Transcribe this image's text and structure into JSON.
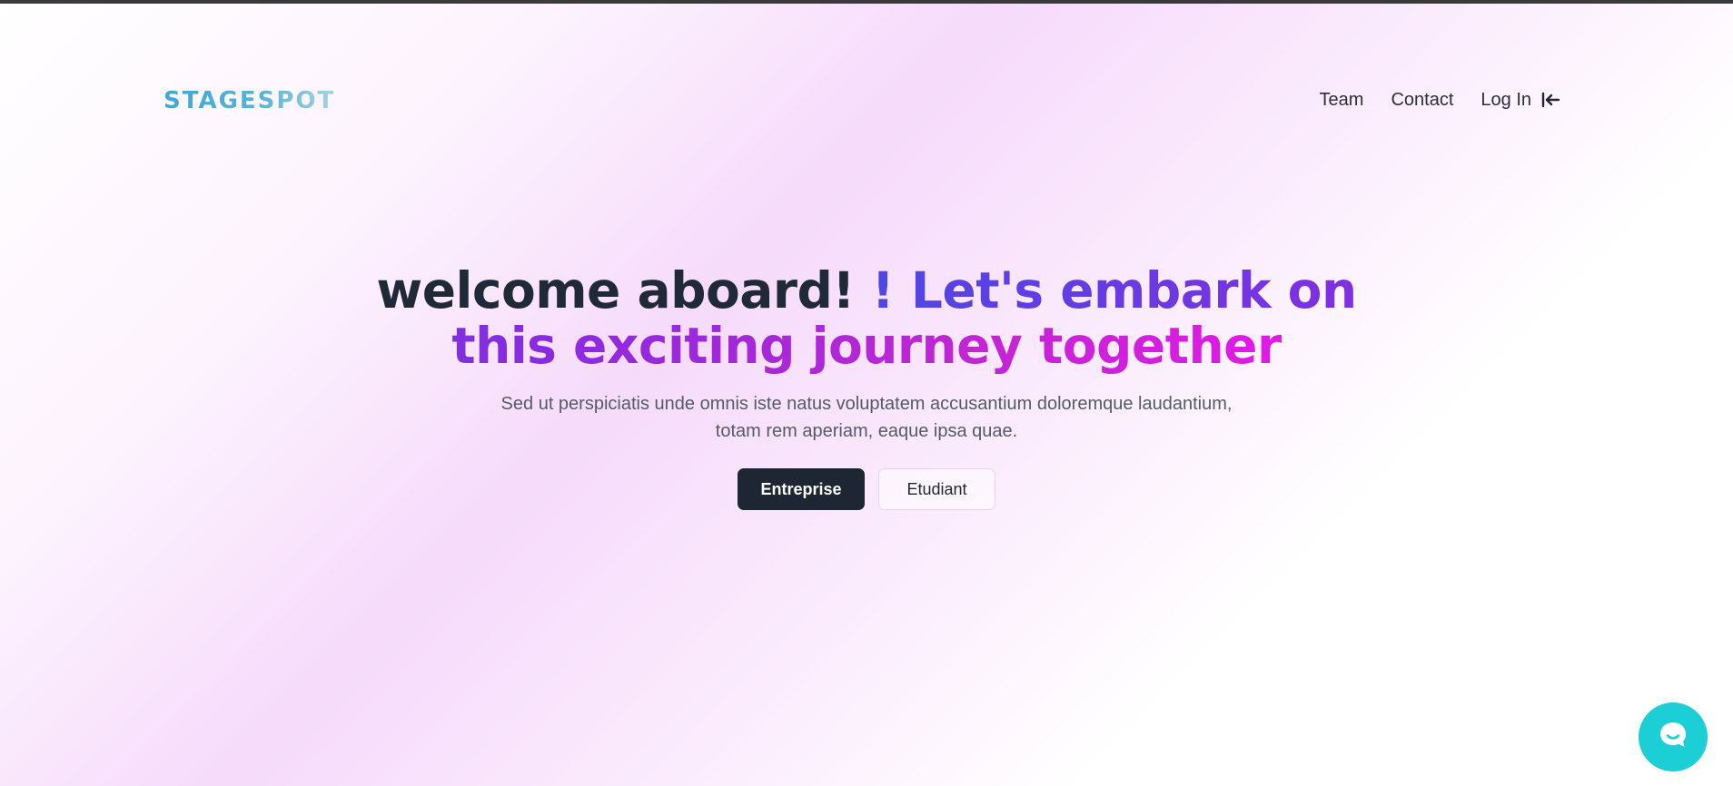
{
  "header": {
    "logo_text": "STAGESPOT",
    "nav": [
      {
        "label": "Team"
      },
      {
        "label": "Contact"
      },
      {
        "label": "Log In",
        "icon": "login-arrow-icon"
      }
    ]
  },
  "hero": {
    "headline_dark": "welcome aboard!",
    "headline_gradient": "! Let's embark on this exciting journey together",
    "subtitle": "Sed ut perspiciatis unde omnis iste natus voluptatem accusantium doloremque laudantium, totam rem aperiam, eaque ipsa quae.",
    "buttons": [
      {
        "label": "Entreprise"
      },
      {
        "label": "Etudiant"
      }
    ]
  },
  "chat_widget": {
    "icon": "chat-bubble-icon"
  },
  "colors": {
    "logo_gradient_start": "#3fa8d8",
    "logo_gradient_end": "#a6d3e4",
    "headline_dark": "#1f2937",
    "headline_gradient_start": "#4f46e5",
    "headline_gradient_end": "#e01ae6",
    "primary_button": "#1f2633",
    "chat_widget": "#1ccfd6",
    "background_tint": "#f6dbfb"
  }
}
